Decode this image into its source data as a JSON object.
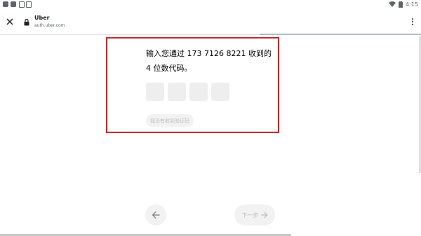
{
  "status_bar": {
    "time": "4:15",
    "icons_left": [
      "app-notification-icon",
      "app-notification-icon",
      "lock-notification-icon",
      "image-notification-icon"
    ],
    "icons_right": [
      "wifi-icon",
      "battery-icon"
    ]
  },
  "browser": {
    "site_title": "Uber",
    "site_url": "auth.uber.com",
    "close_icon": "close-icon",
    "lock_icon": "lock-icon",
    "menu_icon": "more-vert-icon"
  },
  "form": {
    "prompt": "输入您通过 173 7126 8221 收到的 4 位数代码。",
    "code_digits": [
      "",
      "",
      "",
      ""
    ],
    "resend_label": "我没有收到验证码"
  },
  "nav": {
    "back_icon": "arrow-left-icon",
    "next_label": "下一步",
    "next_icon": "arrow-right-icon"
  },
  "colors": {
    "highlight": "#c62828",
    "button_bg": "#f2f2f2",
    "disabled_text": "#bdbdbd"
  }
}
